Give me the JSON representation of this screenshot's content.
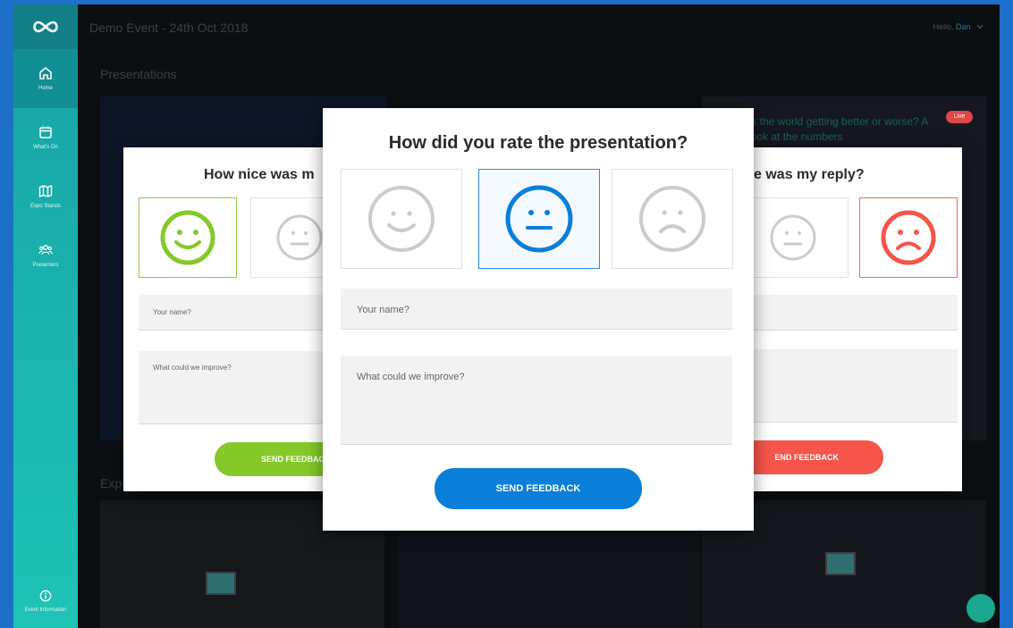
{
  "app": {
    "title": "Demo Event - 24th Oct 2018",
    "greeting": "Hello,",
    "user_name": "Dan"
  },
  "sidebar": {
    "items": [
      {
        "label": "Home",
        "icon": "home-icon",
        "active": true
      },
      {
        "label": "What's On",
        "icon": "calendar-icon",
        "active": false
      },
      {
        "label": "Expo Stands",
        "icon": "map-icon",
        "active": false
      },
      {
        "label": "Presenters",
        "icon": "people-icon",
        "active": false
      }
    ],
    "bottom_item": {
      "label": "Event Information",
      "icon": "info-icon"
    }
  },
  "sections": {
    "presentations": "Presentations",
    "expo": "Exp"
  },
  "background": {
    "question_text": "Is the world getting better or worse? A look at the numbers",
    "live_badge": "Live"
  },
  "cards": {
    "left": {
      "question": "How nice was m",
      "name_placeholder": "Your name?",
      "improve_placeholder": "What could we improve?",
      "button": "SEND FEEDBACK"
    },
    "center": {
      "question": "How did you rate the presentation?",
      "name_placeholder": "Your name?",
      "improve_placeholder": "What could we improve?",
      "button": "SEND FEEDBACK"
    },
    "right": {
      "question": "e was my reply?",
      "button": "END FEEDBACK"
    }
  },
  "colors": {
    "green": "#84c928",
    "blue": "#0a7fd9",
    "red": "#f5554a",
    "gray_face": "#c9cbce",
    "sidebar_teal": "#1fb8b0"
  }
}
